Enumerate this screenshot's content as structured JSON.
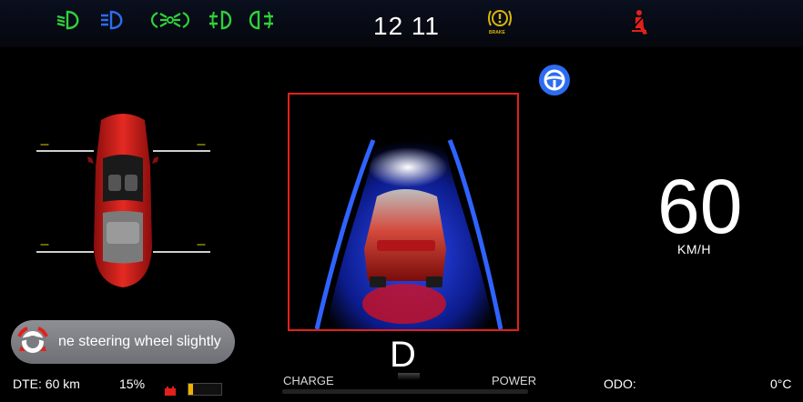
{
  "status_bar": {
    "time": "12 11",
    "brake_label": "BRAKE",
    "colors": {
      "green": "#2fd13a",
      "blue": "#2d6cf2",
      "yellow": "#d9b60b",
      "red": "#e3201b"
    }
  },
  "tires": {
    "front_left": "---",
    "front_right": "---",
    "rear_left": "---",
    "rear_right": "---"
  },
  "speed": {
    "value": "60",
    "unit": "KM/H"
  },
  "gear": "D",
  "alert": {
    "message": "ne steering wheel slightly"
  },
  "footer": {
    "dte": "DTE: 60 km",
    "battery_percent": "15%",
    "charge_label": "CHARGE",
    "power_label": "POWER",
    "odo_label": "ODO:",
    "temperature": "0°C"
  },
  "battery_level": 0.15
}
